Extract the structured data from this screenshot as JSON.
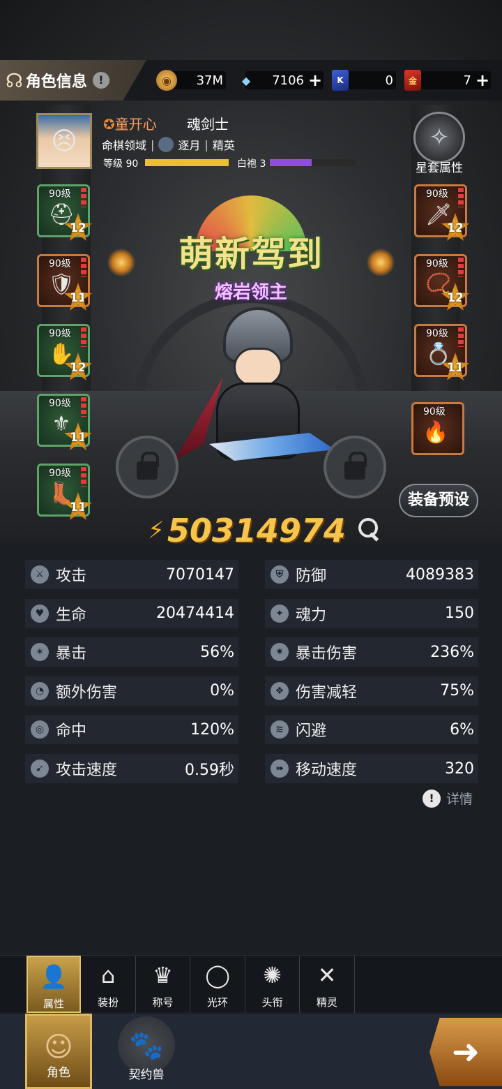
{
  "header": {
    "title": "角色信息",
    "help_icon": "!",
    "resources": [
      {
        "name": "coin",
        "icon": "gold-coin-icon",
        "value": "37M",
        "has_plus": false
      },
      {
        "name": "crystal",
        "icon": "blue-crystal-icon",
        "value": "7106",
        "has_plus": true
      },
      {
        "name": "blue-card",
        "icon": "blue-card-icon",
        "badge": "K",
        "value": "0",
        "has_plus": false
      },
      {
        "name": "red-card",
        "icon": "red-card-icon",
        "badge": "金",
        "value": "7",
        "has_plus": true
      }
    ]
  },
  "profile": {
    "name": "童开心",
    "class": "魂剑士",
    "server": "命棋领域",
    "guild": "逐月",
    "guild_rank": "精英",
    "level_label": "等级 90",
    "level_progress": 1.0,
    "rank_label": "白袍 3",
    "rank_progress": 0.48
  },
  "star_set": {
    "label": "星套属性"
  },
  "equipment": {
    "left": [
      {
        "level": "90级",
        "stars": "12",
        "quality": "green",
        "icon": "helmet-icon"
      },
      {
        "level": "90级",
        "stars": "11",
        "quality": "orange",
        "icon": "armor-icon"
      },
      {
        "level": "90级",
        "stars": "12",
        "quality": "green",
        "icon": "gloves-icon"
      },
      {
        "level": "90级",
        "stars": "11",
        "quality": "green",
        "icon": "belt-icon"
      },
      {
        "level": "90级",
        "stars": "11",
        "quality": "green",
        "icon": "boots-icon"
      }
    ],
    "right": [
      {
        "level": "90级",
        "stars": "12",
        "quality": "orange",
        "icon": "sword-icon"
      },
      {
        "level": "90级",
        "stars": "12",
        "quality": "orange",
        "icon": "necklace-icon"
      },
      {
        "level": "90级",
        "stars": "11",
        "quality": "orange",
        "icon": "ring-icon"
      },
      {
        "level": "90级",
        "quality": "orange",
        "icon": "wing-icon"
      }
    ]
  },
  "banner": {
    "main": "萌新驾到",
    "subtitle": "熔岩领主"
  },
  "preset_button": "装备预设",
  "power": "50314974",
  "stats": [
    {
      "name": "攻击",
      "value": "7070147",
      "icon": "sword-stat-icon",
      "glyph": "⚔"
    },
    {
      "name": "防御",
      "value": "4089383",
      "icon": "shield-stat-icon",
      "glyph": "⛨"
    },
    {
      "name": "生命",
      "value": "20474414",
      "icon": "heart-stat-icon",
      "glyph": "♥"
    },
    {
      "name": "魂力",
      "value": "150",
      "icon": "soul-stat-icon",
      "glyph": "✦"
    },
    {
      "name": "暴击",
      "value": "56%",
      "icon": "crit-stat-icon",
      "glyph": "✶"
    },
    {
      "name": "暴击伤害",
      "value": "236%",
      "icon": "crit-damage-stat-icon",
      "glyph": "✷"
    },
    {
      "name": "额外伤害",
      "value": "0%",
      "icon": "extra-damage-stat-icon",
      "glyph": "◔"
    },
    {
      "name": "伤害减轻",
      "value": "75%",
      "icon": "damage-reduction-stat-icon",
      "glyph": "❖"
    },
    {
      "name": "命中",
      "value": "120%",
      "icon": "target-stat-icon",
      "glyph": "◎"
    },
    {
      "name": "闪避",
      "value": "6%",
      "icon": "dodge-stat-icon",
      "glyph": "≋"
    },
    {
      "name": "攻击速度",
      "value": "0.59秒",
      "icon": "attack-speed-stat-icon",
      "glyph": "➹"
    },
    {
      "name": "移动速度",
      "value": "320",
      "icon": "move-speed-stat-icon",
      "glyph": "➠"
    }
  ],
  "detail_link": "详情",
  "sub_tabs": [
    {
      "label": "属性",
      "icon": "person-icon",
      "glyph": "👤",
      "active": true
    },
    {
      "label": "装扮",
      "icon": "hanger-icon",
      "glyph": "⌂",
      "active": false
    },
    {
      "label": "称号",
      "icon": "crown-icon",
      "glyph": "♛",
      "active": false
    },
    {
      "label": "光环",
      "icon": "halo-icon",
      "glyph": "◯",
      "active": false
    },
    {
      "label": "头衔",
      "icon": "emblem-icon",
      "glyph": "✺",
      "active": false
    },
    {
      "label": "精灵",
      "icon": "fairy-icon",
      "glyph": "✕",
      "active": false
    }
  ],
  "bottom_nav": [
    {
      "label": "角色",
      "icon": "character-head-icon",
      "glyph": "☺",
      "active": true
    },
    {
      "label": "契约兽",
      "icon": "paw-icon",
      "glyph": "🐾",
      "active": false
    }
  ],
  "colors": {
    "accent_gold": "#f7c54a",
    "name_orange": "#ff9b5e",
    "subtitle_purple": "#f2c3ff"
  }
}
